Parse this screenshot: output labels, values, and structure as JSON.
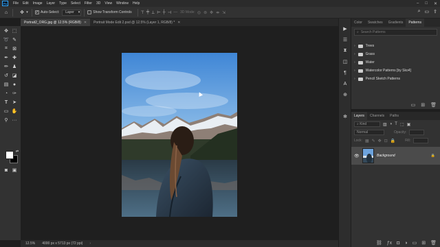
{
  "menu": {
    "logo": "Ps",
    "items": [
      "File",
      "Edit",
      "Image",
      "Layer",
      "Type",
      "Select",
      "Filter",
      "3D",
      "View",
      "Window",
      "Help"
    ],
    "window_controls": [
      "–",
      "□",
      "✕"
    ]
  },
  "options": {
    "auto_select_label": "Auto-Select:",
    "auto_select_checked": true,
    "target_value": "Layer",
    "transform_controls_label": "Show Transform Controls",
    "mode_label": "3D Mode:"
  },
  "tabs": [
    {
      "label": "Portrait2_ORG.jpg @ 12.5% (RGB/8)",
      "active": true
    },
    {
      "label": "Portrait Mode Edit 2.psd @ 12.5% (Layer 1, RGB/8) *",
      "active": false
    }
  ],
  "status": {
    "zoom": "12.5%",
    "doc_info": "4000 px x 5713 px (72 ppi)"
  },
  "patterns_panel": {
    "tabs": [
      "Color",
      "Swatches",
      "Gradients",
      "Patterns"
    ],
    "active_tab": "Patterns",
    "search_placeholder": "Search Patterns",
    "folders": [
      "Trees",
      "Grass",
      "Water",
      "Watercolor Patterns [by Sko4]",
      "Pencil Sketch Patterns"
    ]
  },
  "layers_panel": {
    "tabs": [
      "Layers",
      "Channels",
      "Paths"
    ],
    "active_tab": "Layers",
    "filter_label": "Kind",
    "blend_mode": "Normal",
    "opacity_label": "Opacity:",
    "lock_label": "Lock:",
    "fill_label": "Fill:",
    "layer_name": "Background"
  },
  "colors": {
    "accent": "#31a8ff",
    "foreground": "#ffffff",
    "background": "#000000"
  }
}
